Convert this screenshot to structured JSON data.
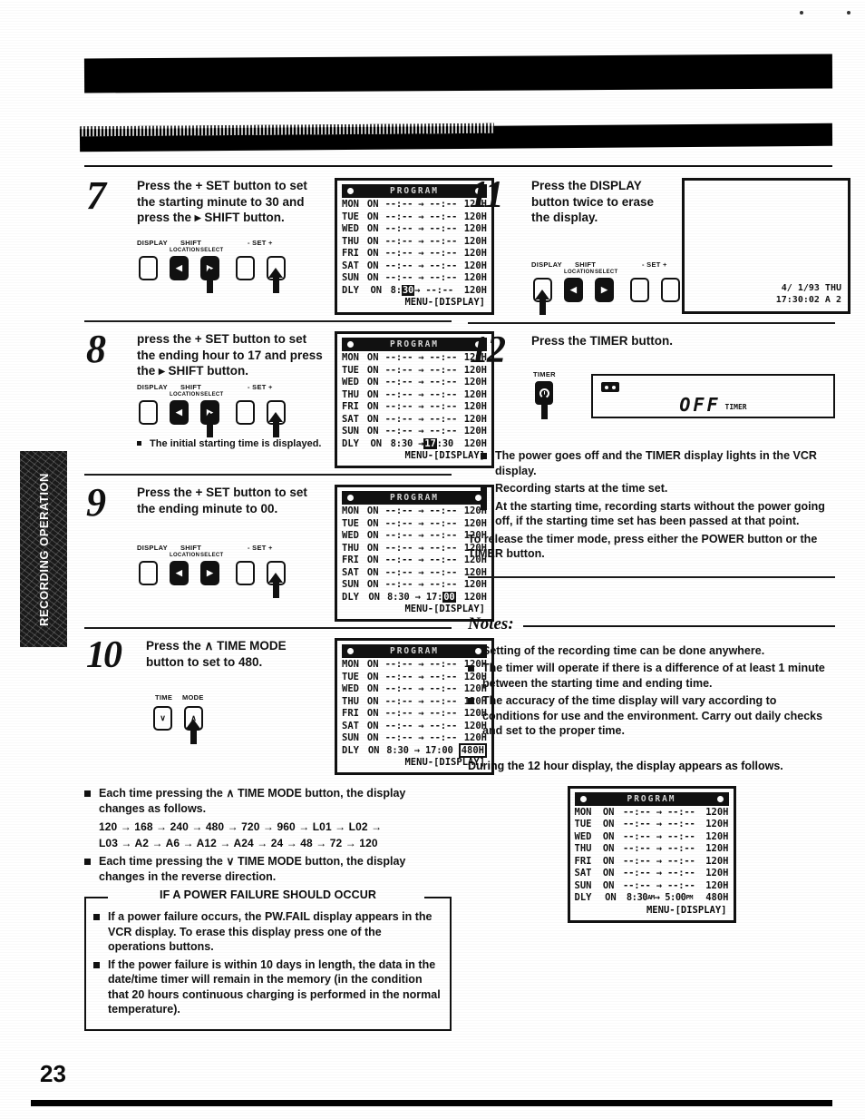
{
  "page": {
    "number": "23",
    "side_tab": "RECORDING OPERATION"
  },
  "osd": {
    "title": "PROGRAM",
    "menu_line": "MENU-[DISPLAY]",
    "on_label": "ON",
    "days": [
      "MON",
      "TUE",
      "WED",
      "THU",
      "FRI",
      "SAT",
      "SUN"
    ],
    "dly_label": "DLY",
    "blank_sched": "--:-- → --:--",
    "default_duration": "120H"
  },
  "steps": [
    {
      "num": "7",
      "text_html": "Press the + <b>SET</b> button to set the starting minute to 30 and press the ▸ <b>SHIFT</b> button.",
      "buttons": {
        "display": "DISPLAY",
        "shift": "SHIFT",
        "location": "LOCATION",
        "select": "SELECT",
        "set": "- SET +"
      },
      "osd_dly": {
        "prefix": "8:",
        "highlight": "30",
        "suffix": "→ --:--",
        "duration": "120H"
      }
    },
    {
      "num": "8",
      "text_html": "press the + <b>SET</b> button to set the ending hour to 17 and press the ▸ <b>SHIFT</b> button.",
      "footnote": "The initial starting time is displayed.",
      "osd_dly": {
        "prefix": "8:30 →",
        "highlight": "17",
        "suffix": ":30",
        "duration": "120H"
      }
    },
    {
      "num": "9",
      "text_html": "Press the + <b>SET</b> button to set the ending minute to 00.",
      "osd_dly": {
        "prefix": "8:30 → 17:",
        "highlight": "00",
        "suffix": "",
        "duration": "120H"
      }
    },
    {
      "num": "10",
      "text_html": "Press the ∧ <b>TIME MODE</b> button to set to 480.",
      "buttons": {
        "time": "TIME",
        "mode": "MODE",
        "down": "∨",
        "up": "∧"
      },
      "osd_dly": {
        "prefix": "8:30 → 17:00",
        "highlight": "",
        "suffix": "",
        "duration": "480H",
        "duration_boxed": true
      }
    },
    {
      "num": "11",
      "text_html": "Press the <b>DISPLAY</b> button twice to erase the display.",
      "screen_stamp_line1": "4/ 1/93 THU",
      "screen_stamp_line2": "17:30:02 A 2"
    },
    {
      "num": "12",
      "text_html": "Press the <b>TIMER</b> button.",
      "buttons": {
        "timer": "TIMER"
      },
      "vfd_text": "OFF",
      "vfd_sub": "TIMER"
    }
  ],
  "time_mode_note": {
    "bullet1_html": "Each time pressing the ∧ <b>TIME MODE</b> button, the display changes as follows.",
    "sequence_line1": "120 → 168 → 240 → 480 → 720 → 960 → L01 → L02 →",
    "sequence_line2": "L03 → A2 → A6 → A12 → A24 → 24 → 48 → 72 → 120",
    "bullet2_html": "Each time pressing the ∨ <b>TIME MODE</b> button, the display changes in the reverse direction."
  },
  "power_failure": {
    "title": "IF A POWER FAILURE SHOULD OCCUR",
    "bullets": [
      "If a power failure occurs, the PW.FAIL display appears in the VCR display. To erase this display press one of the operations buttons.",
      "If the power failure is within 10 days in length, the data in the date/time timer will remain in the memory (in the condition that 20 hours continuous charging is performed in the normal temperature)."
    ]
  },
  "timer_result": {
    "bullets": [
      "The power goes off and the TIMER display lights in the VCR display.",
      "Recording starts at the time set.",
      "At the starting time, recording starts without the power going off, if the starting time set has been passed at that point."
    ],
    "release_html": "To release the timer mode, press either the <b>POWER</b> button or the <b>TIMER</b> button."
  },
  "notes": {
    "heading": "Notes:",
    "items": [
      "Setting of the recording time can be done anywhere.",
      "The timer will operate if there is a difference of at least 1 minute between the starting time and ending time.",
      "The accuracy of the time display will vary according to conditions for use and the environment. Carry out daily checks and set to the proper time."
    ]
  },
  "twelve_hour": {
    "intro": "During the 12 hour display, the display appears as follows.",
    "dly_line": "8:30ᴀ→ 5:00ᴘ 480H",
    "dly_prefix": "8:30",
    "dly_am": "AM",
    "dly_mid": "→ 5:00",
    "dly_pm": "PM",
    "dly_duration": "480H"
  }
}
